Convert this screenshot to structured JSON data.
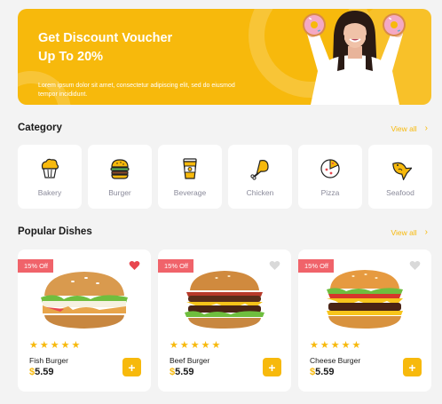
{
  "banner": {
    "title_line1": "Get Discount Voucher",
    "title_line2": "Up To 20%",
    "description": "Lorem ipsum dolor sit amet, consectetur adipiscing elit, sed do eiusmod tempor incididunt."
  },
  "category": {
    "title": "Category",
    "view_all": "View all",
    "items": [
      {
        "label": "Bakery",
        "icon": "muffin-icon"
      },
      {
        "label": "Burger",
        "icon": "burger-icon"
      },
      {
        "label": "Beverage",
        "icon": "coffee-cup-icon"
      },
      {
        "label": "Chicken",
        "icon": "drumstick-icon"
      },
      {
        "label": "Pizza",
        "icon": "pizza-icon"
      },
      {
        "label": "Seafood",
        "icon": "fish-icon"
      }
    ]
  },
  "popular": {
    "title": "Popular Dishes",
    "view_all": "View all",
    "dishes": [
      {
        "badge": "15% Off",
        "name": "Fish Burger",
        "currency": "$",
        "price": "5.59",
        "rating": 5,
        "favorite": true
      },
      {
        "badge": "15% Off",
        "name": "Beef Burger",
        "currency": "$",
        "price": "5.59",
        "rating": 5,
        "favorite": false
      },
      {
        "badge": "15% Off",
        "name": "Cheese Burger",
        "currency": "$",
        "price": "5.59",
        "rating": 5,
        "favorite": false
      }
    ]
  },
  "colors": {
    "accent": "#f7b90c",
    "badge": "#f0636a",
    "heart_active": "#e8474f",
    "heart_inactive": "#d9d9d9"
  }
}
